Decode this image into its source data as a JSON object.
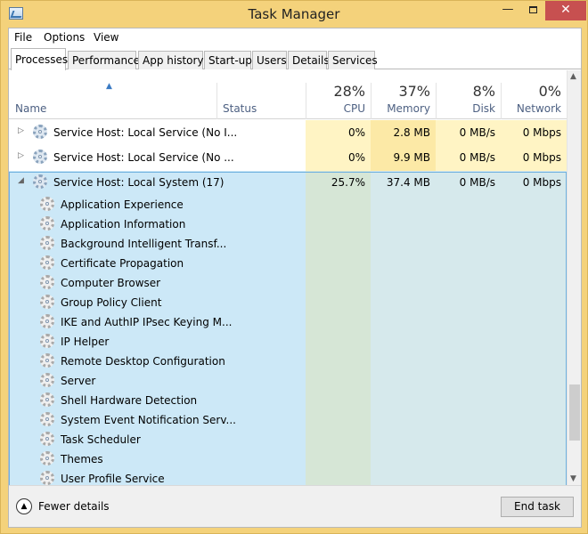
{
  "window": {
    "title": "Task Manager",
    "minimize_glyph": "—",
    "close_glyph": "✕"
  },
  "menu": {
    "file": "File",
    "options": "Options",
    "view": "View"
  },
  "tabs": [
    "Processes",
    "Performance",
    "App history",
    "Start-up",
    "Users",
    "Details",
    "Services"
  ],
  "columns": {
    "name": "Name",
    "status": "Status",
    "cpu": {
      "pct": "28%",
      "label": "CPU"
    },
    "memory": {
      "pct": "37%",
      "label": "Memory"
    },
    "disk": {
      "pct": "8%",
      "label": "Disk"
    },
    "network": {
      "pct": "0%",
      "label": "Network"
    }
  },
  "processes": [
    {
      "name": "Service Host: Local Service (No I...",
      "cpu": "0%",
      "memory": "2.8 MB",
      "disk": "0 MB/s",
      "network": "0 Mbps"
    },
    {
      "name": "Service Host: Local Service (No ...",
      "cpu": "0%",
      "memory": "9.9 MB",
      "disk": "0 MB/s",
      "network": "0 Mbps"
    },
    {
      "name": "Service Host: Local System (17)",
      "cpu": "25.7%",
      "memory": "37.4 MB",
      "disk": "0 MB/s",
      "network": "0 Mbps"
    }
  ],
  "services": [
    "Application Experience",
    "Application Information",
    "Background Intelligent Transf...",
    "Certificate Propagation",
    "Computer Browser",
    "Group Policy Client",
    "IKE and AuthIP IPsec Keying M...",
    "IP Helper",
    "Remote Desktop Configuration",
    "Server",
    "Shell Hardware Detection",
    "System Event Notification Serv...",
    "Task Scheduler",
    "Themes",
    "User Profile Service"
  ],
  "footer": {
    "fewer_details": "Fewer details",
    "end_task": "End task"
  },
  "colors": {
    "frame": "#f4d27b",
    "selection": "#cce8f7",
    "selection_border": "#6fb0df",
    "heat_light": "#fff4c4",
    "heat_cpu_group": "#d8e6d8",
    "accent": "#3a7ac3"
  }
}
